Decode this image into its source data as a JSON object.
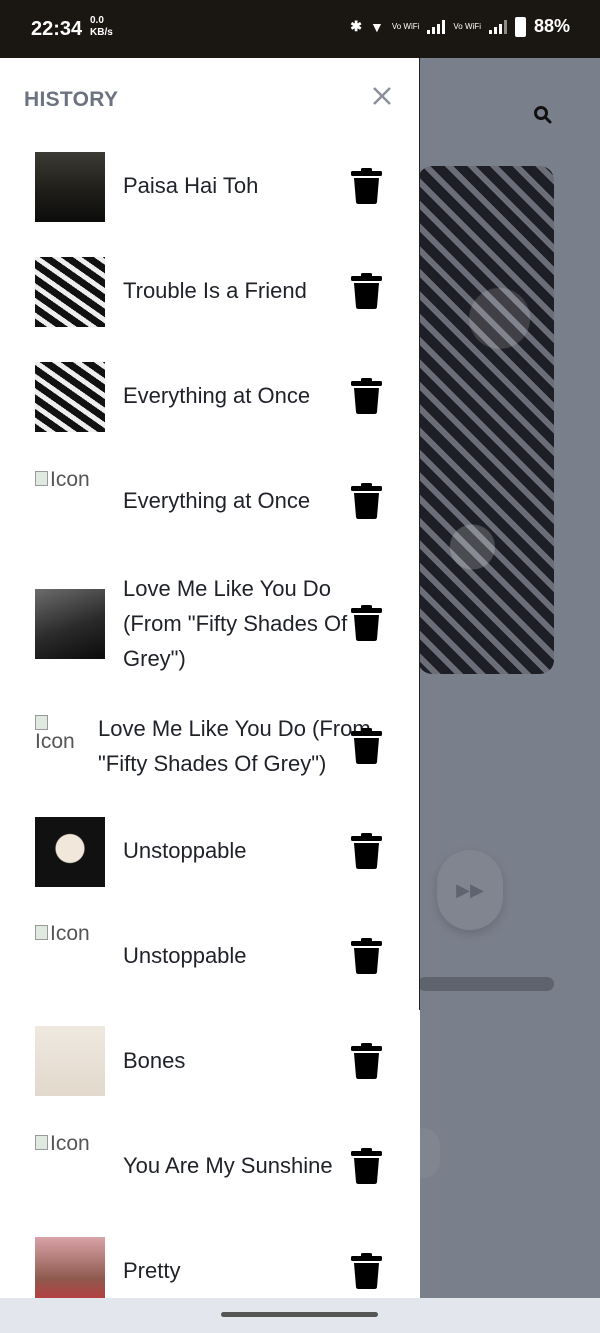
{
  "status_bar": {
    "time": "22:34",
    "speed_value": "0.0",
    "speed_unit": "KB/s",
    "vowifi": "Vo WiFi",
    "battery": "88%"
  },
  "drawer": {
    "title": "HISTORY",
    "close_icon": "close-icon",
    "items": [
      {
        "title": "Paisa Hai Toh",
        "thumb": "farzi",
        "has_image": true
      },
      {
        "title": "Trouble Is a Friend",
        "thumb": "lenka",
        "has_image": true
      },
      {
        "title": "Everything at Once",
        "thumb": "lenka",
        "has_image": true
      },
      {
        "title": "Everything at Once",
        "thumb": "",
        "has_image": false,
        "alt": "Icon"
      },
      {
        "title": "Love Me Like You Do (From \"Fifty Shades Of Grey\")",
        "thumb": "fifty",
        "has_image": true
      },
      {
        "title": "Love Me Like You Do (From \"Fifty Shades Of Grey\")",
        "thumb": "",
        "has_image": false,
        "alt": "Icon"
      },
      {
        "title": "Unstoppable",
        "thumb": "sia",
        "has_image": true
      },
      {
        "title": "Unstoppable",
        "thumb": "",
        "has_image": false,
        "alt": "Icon"
      },
      {
        "title": "Bones",
        "thumb": "bones",
        "has_image": true
      },
      {
        "title": "You Are My Sunshine",
        "thumb": "",
        "has_image": false,
        "alt": "Icon"
      },
      {
        "title": "Pretty",
        "thumb": "pretty",
        "has_image": true
      }
    ]
  },
  "colors": {
    "status_bar_bg": "#1a1712",
    "drawer_bg": "#ffffff",
    "title_gray": "#6b7280",
    "overlay": "#7a7f8c"
  }
}
